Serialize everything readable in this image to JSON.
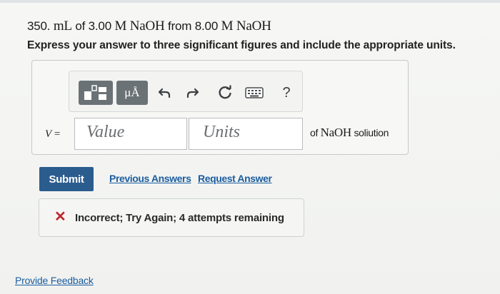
{
  "question": {
    "amount": "350.",
    "volume_unit": "mL",
    "of_1": " of ",
    "conc_1": "3.00",
    "molar_1": "M NaOH",
    "from": " from ",
    "conc_2": "8.00",
    "molar_2": "M NaOH"
  },
  "instruction": "Express your answer to three significant figures and include the appropriate units.",
  "toolbar": {
    "units_label": "μÅ",
    "undo_icon": "undo-icon",
    "redo_icon": "redo-icon",
    "reset_icon": "reset-icon",
    "keyboard_icon": "keyboard-icon",
    "help_label": "?"
  },
  "answer": {
    "variable": "V",
    "equals": " =",
    "value_placeholder": "Value",
    "units_placeholder": "Units",
    "suffix_pre": "of ",
    "suffix_species": "NaOH",
    "suffix_post": " soliution"
  },
  "actions": {
    "submit_label": "Submit",
    "previous_answers_label": "Previous Answers",
    "request_answer_label": "Request Answer"
  },
  "feedback": {
    "icon": "x-icon",
    "message": "Incorrect; Try Again; 4 attempts remaining",
    "color": "#c1262b"
  },
  "footer": {
    "provide_feedback_label": "Provide Feedback"
  },
  "colors": {
    "submit_bg": "#2b5c8e",
    "link": "#1a5d9e",
    "toolbar_button": "#6b7276"
  }
}
